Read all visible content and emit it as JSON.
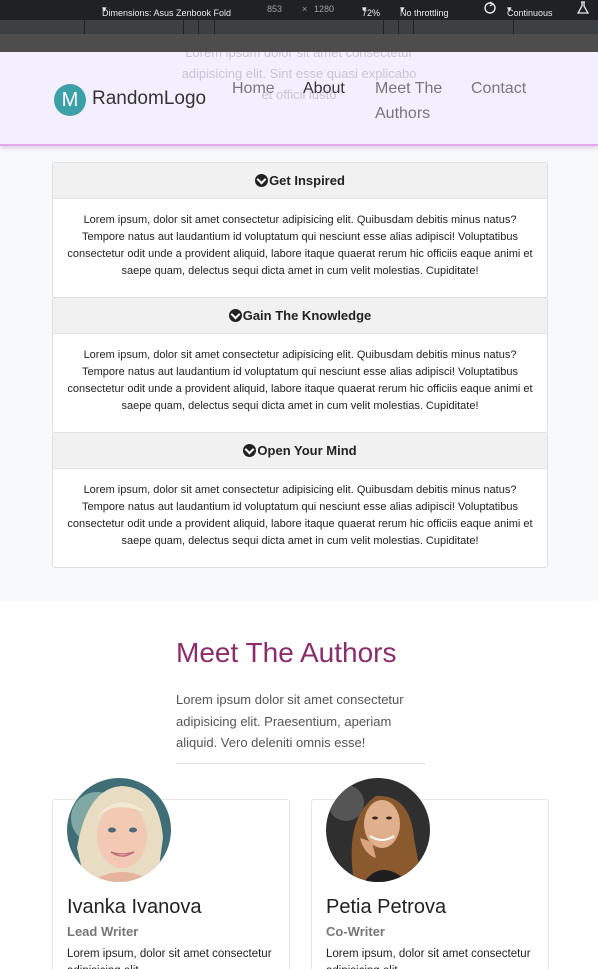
{
  "devtools": {
    "device": "Dimensions: Asus Zenbook Fold",
    "width": "853",
    "times": "×",
    "height": "1280",
    "zoom": "72%",
    "throttle": "No throttling",
    "mode": "Continuous"
  },
  "navbar": {
    "logo_letter": "M",
    "logo_text": "RandomLogo",
    "ghost_line1": "Lorem ipsum dolor sit amet consectetur",
    "ghost_line2": "adipisicing elit. Sint esse quasi explicabo",
    "ghost_line3": "et officii iusto",
    "links": [
      "Home",
      "About",
      "Meet The",
      "Authors",
      "Contact"
    ]
  },
  "accordion": {
    "items": [
      {
        "title": "Get Inspired",
        "body": "Lorem ipsum, dolor sit amet consectetur adipisicing elit. Quibusdam debitis minus natus? Tempore natus aut laudantium id voluptatum qui nesciunt esse alias adipisci! Voluptatibus consectetur odit unde a provident aliquid, labore itaque quaerat rerum hic officiis eaque animi et saepe quam, delectus sequi dicta amet in cum velit molestias. Cupiditate!"
      },
      {
        "title": "Gain The Knowledge",
        "body": "Lorem ipsum, dolor sit amet consectetur adipisicing elit. Quibusdam debitis minus natus? Tempore natus aut laudantium id voluptatum qui nesciunt esse alias adipisci! Voluptatibus consectetur odit unde a provident aliquid, labore itaque quaerat rerum hic officiis eaque animi et saepe quam, delectus sequi dicta amet in cum velit molestias. Cupiditate!"
      },
      {
        "title": "Open Your Mind",
        "body": "Lorem ipsum, dolor sit amet consectetur adipisicing elit. Quibusdam debitis minus natus? Tempore natus aut laudantium id voluptatum qui nesciunt esse alias adipisci! Voluptatibus consectetur odit unde a provident aliquid, labore itaque quaerat rerum hic officiis eaque animi et saepe quam, delectus sequi dicta amet in cum velit molestias. Cupiditate!"
      }
    ]
  },
  "authors_section": {
    "title": "Meet The Authors",
    "lead": "Lorem ipsum dolor sit amet consectetur adipisicing elit. Praesentium, aperiam aliquid. Vero deleniti omnis esse!",
    "authors": [
      {
        "name": "Ivanka Ivanova",
        "role": "Lead Writer",
        "text": "Lorem ipsum, dolor sit amet consectetur adipisicing elit."
      },
      {
        "name": "Petia Petrova",
        "role": "Co-Writer",
        "text": "Lorem ipsum, dolor sit amet consectetur adipisicing elit."
      }
    ]
  },
  "colors": {
    "accent": "#8b2d6b",
    "logo": "#3ba0a8",
    "navbar_bg": "#f3efff"
  }
}
